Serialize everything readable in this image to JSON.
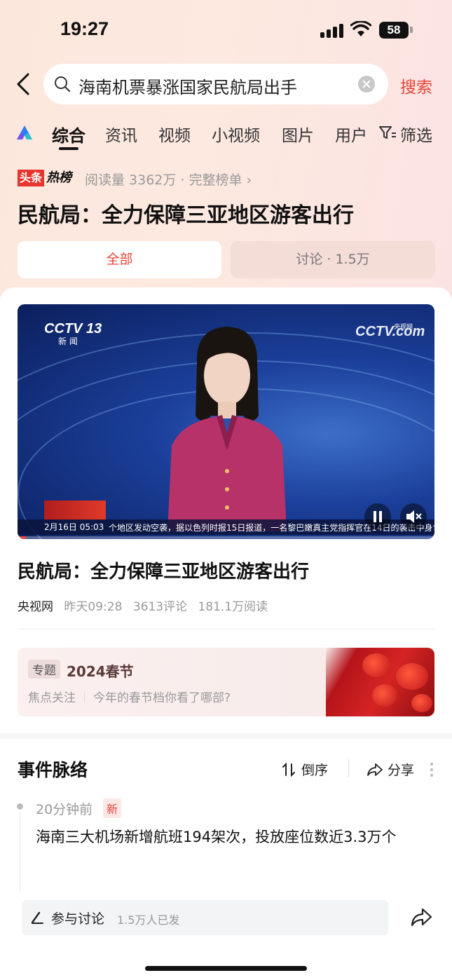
{
  "status_bar": {
    "time": "19:27",
    "battery": "58"
  },
  "search": {
    "query": "海南机票暴涨国家民航局出手",
    "submit_label": "搜索"
  },
  "tabs": [
    {
      "label": "综合",
      "active": true
    },
    {
      "label": "资讯"
    },
    {
      "label": "视频"
    },
    {
      "label": "小视频"
    },
    {
      "label": "图片"
    },
    {
      "label": "用户"
    }
  ],
  "filter_label": "筛选",
  "hot": {
    "badge_left": "头条",
    "badge_right": "热榜",
    "meta": "阅读量 3362万 · 完整榜单 ›",
    "title": "民航局：全力保障三亚地区游客出行"
  },
  "segments": {
    "all": "全部",
    "discuss": "讨论 · 1.5万"
  },
  "video": {
    "channel_logo": "CCTV 13",
    "channel_sub": "新 闻",
    "site_logo": "CCTV.com",
    "site_sub": "央视网",
    "ticker_date": "2月16日  05:03",
    "ticker_text": "个地区发动空袭，据以色列时报15日报道，一名黎巴嫩真主党指挥官在14日的袭击中身亡",
    "progress": 0.02
  },
  "article": {
    "title": "民航局：全力保障三亚地区游客出行",
    "source": "央视网",
    "time": "昨天09:28",
    "comments": "3613评论",
    "reads": "181.1万阅读"
  },
  "topic": {
    "tag": "专题",
    "title": "2024春节",
    "sub_left": "焦点关注",
    "sub_right": "今年的春节档你看了哪部?"
  },
  "timeline": {
    "heading": "事件脉络",
    "sort_label": "倒序",
    "share_label": "分享",
    "items": [
      {
        "time": "20分钟前",
        "badge": "新",
        "text": "海南三大机场新增航班194架次，投放座位数近3.3万个"
      }
    ]
  },
  "bottom_bar": {
    "label": "参与讨论",
    "count": "1.5万人已发"
  },
  "colors": {
    "accent": "#e6453a",
    "hot_red": "#e8352d"
  }
}
